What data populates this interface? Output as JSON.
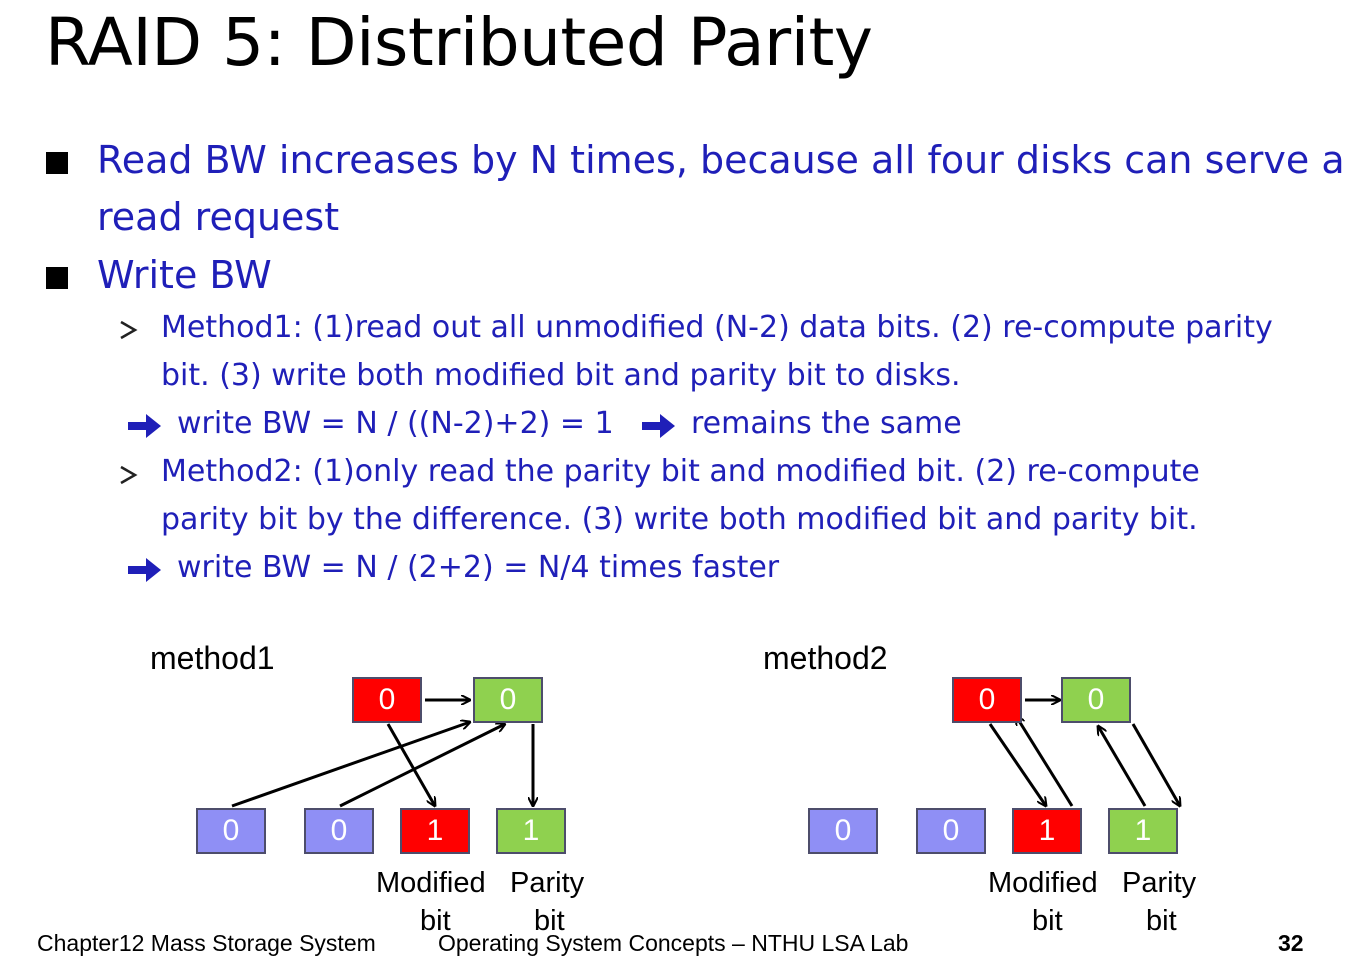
{
  "slide": {
    "title": "RAID 5: Distributed Parity"
  },
  "bullets": {
    "b1_line1": "Read BW increases by N times, because all four disks can serve a",
    "b1_line2": "read request",
    "b2": "Write BW"
  },
  "methods": {
    "m1_line1": "Method1: (1)read out all unmodified (N-2) data bits. (2) re-compute parity",
    "m1_line2": "bit. (3) write both modified bit and parity bit to disks.",
    "m1_result_a": "write BW = N / ((N-2)+2) = 1",
    "m1_result_b": "remains the same",
    "m2_line1": "Method2: (1)only read the parity bit and modified bit. (2) re-compute",
    "m2_line2": "parity bit by the difference. (3) write both modified bit and parity bit.",
    "m2_result": "write BW = N / (2+2) = N/4 times faster"
  },
  "diagram1": {
    "label": "method1",
    "top": [
      "0",
      "0"
    ],
    "bottom": [
      "0",
      "0",
      "1",
      "1"
    ],
    "cap_modified_1": "Modified",
    "cap_modified_2": "bit",
    "cap_parity_1": "Parity",
    "cap_parity_2": "bit"
  },
  "diagram2": {
    "label": "method2",
    "top": [
      "0",
      "0"
    ],
    "bottom": [
      "0",
      "0",
      "1",
      "1"
    ],
    "cap_modified_1": "Modified",
    "cap_modified_2": "bit",
    "cap_parity_1": "Parity",
    "cap_parity_2": "bit"
  },
  "footer": {
    "chapter": "Chapter12  Mass Storage System",
    "course": "Operating System Concepts – NTHU LSA Lab",
    "page": "32"
  },
  "colors": {
    "text_blue": "#1f1fb8",
    "modified_red": "#ff0000",
    "parity_green": "#8fd14f",
    "data_lavender": "#8f8ff5"
  }
}
